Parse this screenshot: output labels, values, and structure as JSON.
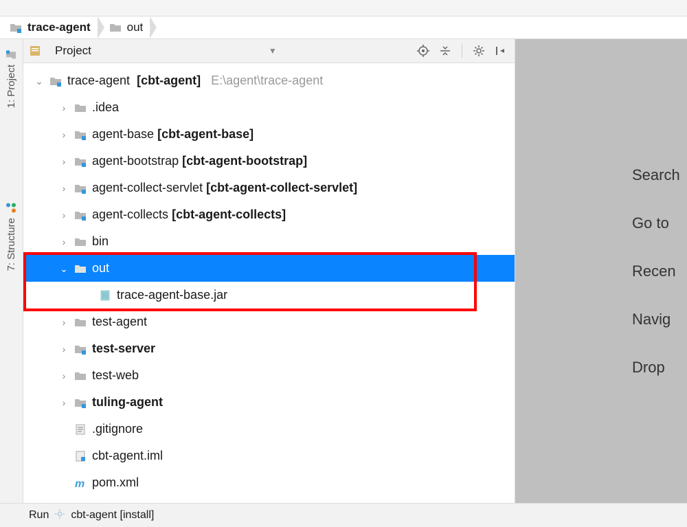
{
  "breadcrumb": [
    {
      "label": "trace-agent",
      "bold": true,
      "iconType": "module"
    },
    {
      "label": "out",
      "bold": false,
      "iconType": "folder"
    }
  ],
  "leftStrip": {
    "project": "1: Project",
    "structure": "7: Structure"
  },
  "panel": {
    "title": "Project"
  },
  "tree": {
    "root": {
      "label": "trace-agent",
      "bracket": "[cbt-agent]",
      "path": "E:\\agent\\trace-agent"
    },
    "items": [
      {
        "type": "folder",
        "label": ".idea",
        "arrow": "right",
        "depth": 2,
        "icon": "folder-plain"
      },
      {
        "type": "module",
        "label": "agent-base",
        "bracket": "[cbt-agent-base]",
        "arrow": "right",
        "depth": 2,
        "icon": "folder-module"
      },
      {
        "type": "module",
        "label": "agent-bootstrap",
        "bracket": "[cbt-agent-bootstrap]",
        "arrow": "right",
        "depth": 2,
        "icon": "folder-module"
      },
      {
        "type": "module",
        "label": "agent-collect-servlet",
        "bracket": "[cbt-agent-collect-servlet]",
        "arrow": "right",
        "depth": 2,
        "icon": "folder-module"
      },
      {
        "type": "module",
        "label": "agent-collects",
        "bracket": "[cbt-agent-collects]",
        "arrow": "right",
        "depth": 2,
        "icon": "folder-module"
      },
      {
        "type": "folder",
        "label": "bin",
        "arrow": "right",
        "depth": 2,
        "icon": "folder-plain"
      },
      {
        "type": "folder",
        "label": "out",
        "arrow": "down",
        "depth": 2,
        "icon": "folder-plain",
        "selected": true
      },
      {
        "type": "file",
        "label": "trace-agent-base.jar",
        "arrow": "none",
        "depth": 3,
        "icon": "jar"
      },
      {
        "type": "folder",
        "label": "test-agent",
        "arrow": "right",
        "depth": 2,
        "icon": "folder-plain"
      },
      {
        "type": "module-bold",
        "label": "test-server",
        "arrow": "right",
        "depth": 2,
        "icon": "folder-module"
      },
      {
        "type": "folder",
        "label": "test-web",
        "arrow": "right",
        "depth": 2,
        "icon": "folder-plain"
      },
      {
        "type": "module-bold",
        "label": "tuling-agent",
        "arrow": "right",
        "depth": 2,
        "icon": "folder-module"
      },
      {
        "type": "file",
        "label": ".gitignore",
        "arrow": "none",
        "depth": 2,
        "icon": "text"
      },
      {
        "type": "file",
        "label": "cbt-agent.iml",
        "arrow": "none",
        "depth": 2,
        "icon": "iml"
      },
      {
        "type": "file",
        "label": "pom.xml",
        "arrow": "none",
        "depth": 2,
        "icon": "maven"
      }
    ]
  },
  "tips": [
    "Search",
    "Go to",
    "Recen",
    "Navig",
    "Drop "
  ],
  "bottomBar": {
    "run": "Run",
    "config": "cbt-agent [install]"
  }
}
